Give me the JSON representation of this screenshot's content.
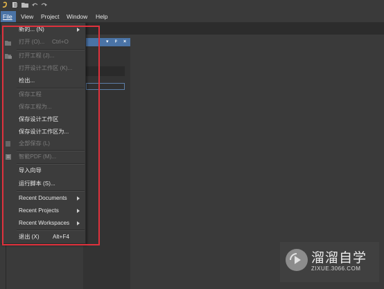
{
  "menubar": {
    "items": [
      "File",
      "View",
      "Project",
      "Window",
      "Help"
    ]
  },
  "file_menu": {
    "new": "新的... (N)",
    "open": "打开 (O)...",
    "open_shortcut": "Ctrl+O",
    "open_project": "打开工程 (J)...",
    "open_design_workspace": "打开设计工作区 (K)...",
    "checkout": "检出...",
    "save_project": "保存工程",
    "save_project_as": "保存工程为...",
    "save_design_workspace": "保存设计工作区",
    "save_design_workspace_as": "保存设计工作区为...",
    "save_all": "全部保存 (L)",
    "smart_pdf": "智能PDF (M)...",
    "import_wizard": "导入向导",
    "run_script": "运行脚本 (S)...",
    "recent_documents": "Recent Documents",
    "recent_projects": "Recent Projects",
    "recent_workspaces": "Recent Workspaces",
    "exit": "退出 (X)",
    "exit_shortcut": "Alt+F4"
  },
  "watermark": {
    "title": "溜溜自学",
    "url": "ZIXUE.3066.COM"
  },
  "colors": {
    "menubar_active": "#4a73a6",
    "highlight_box": "#e0313c"
  }
}
